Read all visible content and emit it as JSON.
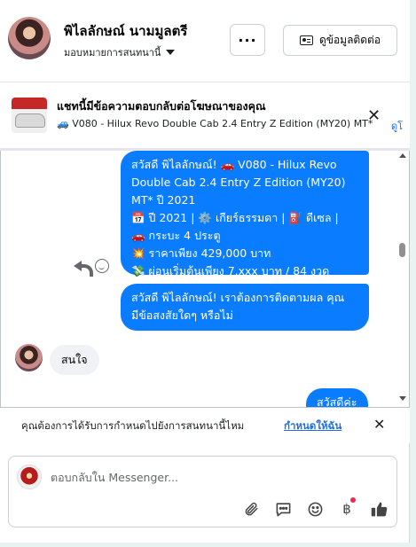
{
  "header": {
    "name": "พิไลลักษณ์ นามมูลตรี",
    "assign_label": "มอบหมายการสนทนานี้",
    "more_label": "···",
    "contact_button": "ดูข้อมูลติดต่อ"
  },
  "ad": {
    "title": "แชทนี้มีข้อความตอบกลับต่อโฆษณาของคุณ",
    "subtitle": "🚙 V080 - Hilux Revo Double Cab 2.4 Entry Z Edition (MY20) MT*",
    "close": "✕",
    "link": "ดูโ"
  },
  "messages": {
    "m1": {
      "l1": "สวัสดี พิไลลักษณ์! 🚗 V080 - Hilux Revo",
      "l2": "Double Cab 2.4 Entry Z Edition (MY20)",
      "l3": "MT* ปี 2021",
      "l4": "📅 ปี 2021 | ⚙️ เกียร์ธรรมดา | ⛽ ดีเซล |",
      "l5": "🚗 กระบะ 4 ประตู",
      "l6": "💥 ราคาเพียง 429,000 บาท",
      "l7": "💸 ผ่อนเริ่มต้นเพียง 7,xxx บาท / 84 งวด"
    },
    "m2": {
      "l1": "สวัสดี พิไลลักษณ์! เราต้องการติดตามผล คุณ",
      "l2": "มีข้อสงสัยใดๆ หรือไม่"
    },
    "m3": "สนใจ",
    "m4": "สวัสดีค่ะ"
  },
  "notice": {
    "text": "คุณต้องการได้รับการกำหนดไปยังการสนทนานี้ไหม",
    "link": "กำหนดให้ฉัน",
    "close": "✕"
  },
  "composer": {
    "placeholder": "ตอบกลับใน Messenger..."
  },
  "icons": {
    "attach": "paperclip-icon",
    "saved_replies": "chat-bubble-icon",
    "emoji": "smile-icon",
    "payment": "baht-icon",
    "like": "thumbs-up-icon"
  },
  "colors": {
    "bubble_out": "#0a7cff",
    "bubble_in": "#f0f2f5",
    "link": "#216fdb",
    "notification_dot": "#f02849"
  }
}
